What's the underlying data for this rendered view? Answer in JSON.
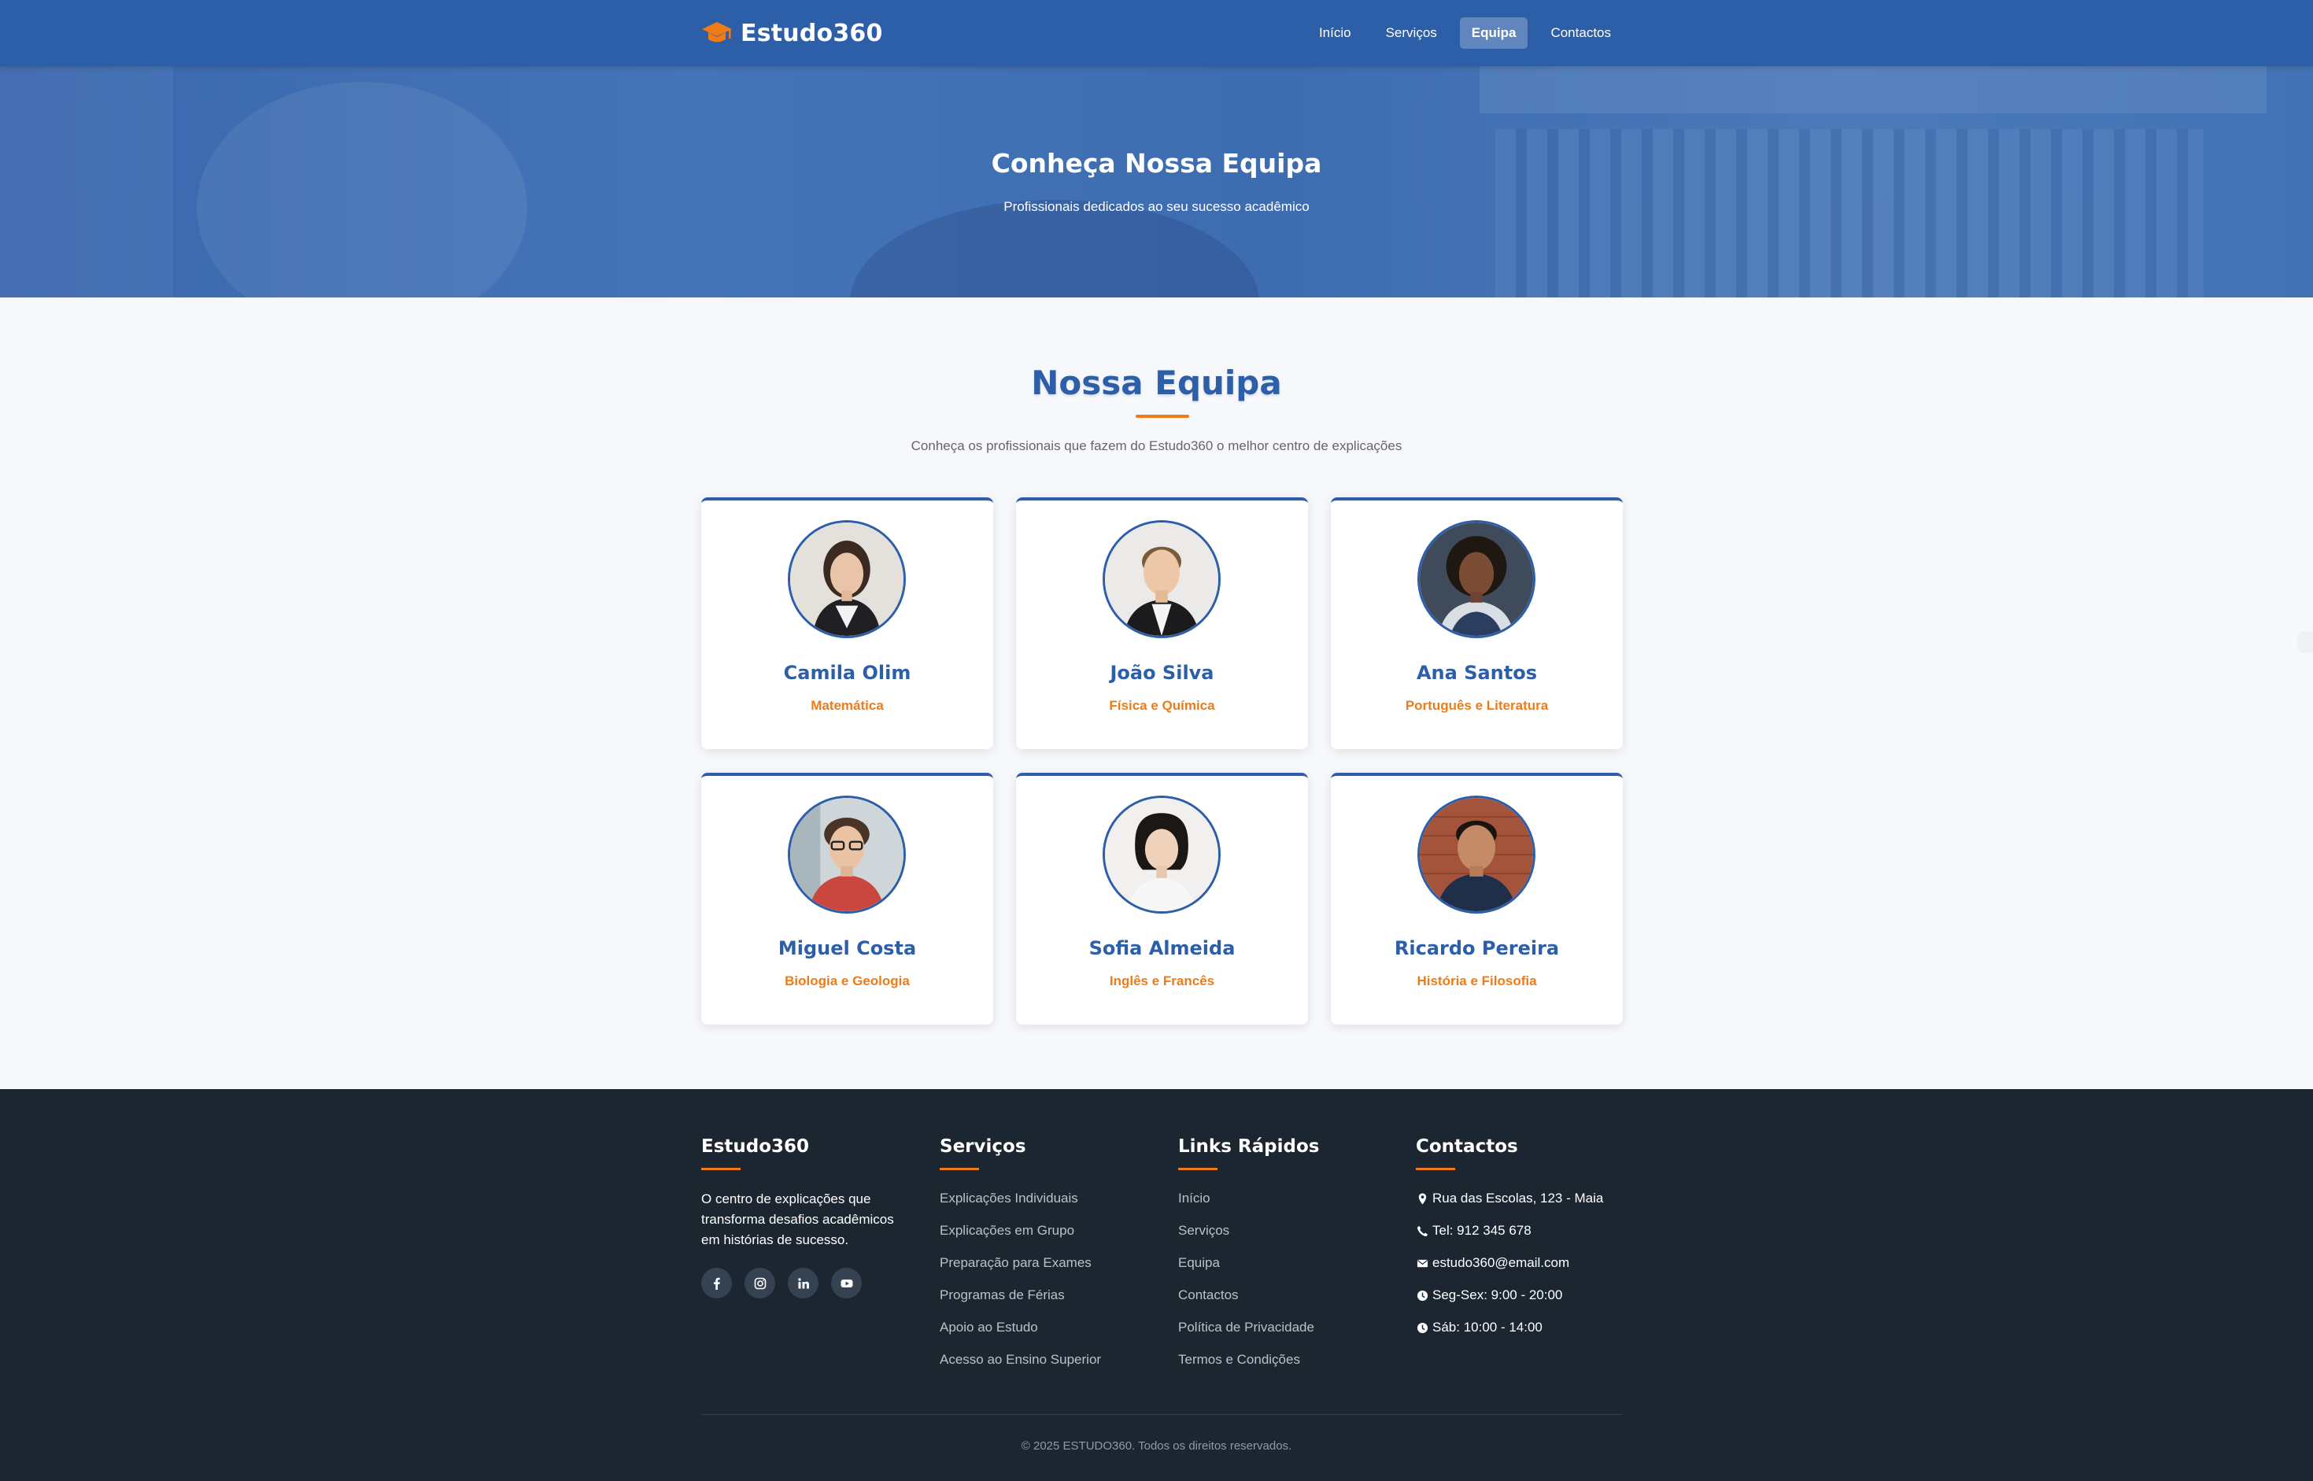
{
  "nav": {
    "brand": "Estudo360",
    "items": [
      {
        "label": "Início",
        "active": false
      },
      {
        "label": "Serviços",
        "active": false
      },
      {
        "label": "Equipa",
        "active": true
      },
      {
        "label": "Contactos",
        "active": false
      }
    ],
    "logo_icon": "graduation-cap-icon"
  },
  "hero": {
    "title": "Conheça Nossa Equipa",
    "subtitle": "Profissionais dedicados ao seu sucesso acadêmico"
  },
  "team": {
    "title": "Nossa Equipa",
    "subtitle": "Conheça os profissionais que fazem do Estudo360 o melhor centro de explicações",
    "members": [
      {
        "name": "Camila Olim",
        "subject": "Matemática"
      },
      {
        "name": "João Silva",
        "subject": "Física e Química"
      },
      {
        "name": "Ana Santos",
        "subject": "Português e Literatura"
      },
      {
        "name": "Miguel Costa",
        "subject": "Biologia e Geologia"
      },
      {
        "name": "Sofia Almeida",
        "subject": "Inglês e Francês"
      },
      {
        "name": "Ricardo Pereira",
        "subject": "História e Filosofia"
      }
    ]
  },
  "footer": {
    "about": {
      "title": "Estudo360",
      "text": "O centro de explicações que transforma desafios acadêmicos em histórias de sucesso.",
      "socials": [
        "facebook-icon",
        "instagram-icon",
        "linkedin-icon",
        "youtube-icon"
      ]
    },
    "services": {
      "title": "Serviços",
      "items": [
        "Explicações Individuais",
        "Explicações em Grupo",
        "Preparação para Exames",
        "Programas de Férias",
        "Apoio ao Estudo",
        "Acesso ao Ensino Superior"
      ]
    },
    "links": {
      "title": "Links Rápidos",
      "items": [
        "Início",
        "Serviços",
        "Equipa",
        "Contactos",
        "Política de Privacidade",
        "Termos e Condições"
      ]
    },
    "contacts": {
      "title": "Contactos",
      "items": [
        {
          "icon": "map-pin-icon",
          "text": "Rua das Escolas, 123 - Maia"
        },
        {
          "icon": "phone-icon",
          "text": "Tel: 912 345 678"
        },
        {
          "icon": "envelope-icon",
          "text": "estudo360@email.com"
        },
        {
          "icon": "clock-icon",
          "text": "Seg-Sex: 9:00 - 20:00"
        },
        {
          "icon": "clock-icon",
          "text": "Sáb: 10:00 - 14:00"
        }
      ]
    },
    "copyright": "© 2025 ESTUDO360. Todos os direitos reservados."
  },
  "colors": {
    "primary": "#2d5ea8",
    "accent": "#f07b16",
    "footer_bg": "#1c2631"
  }
}
